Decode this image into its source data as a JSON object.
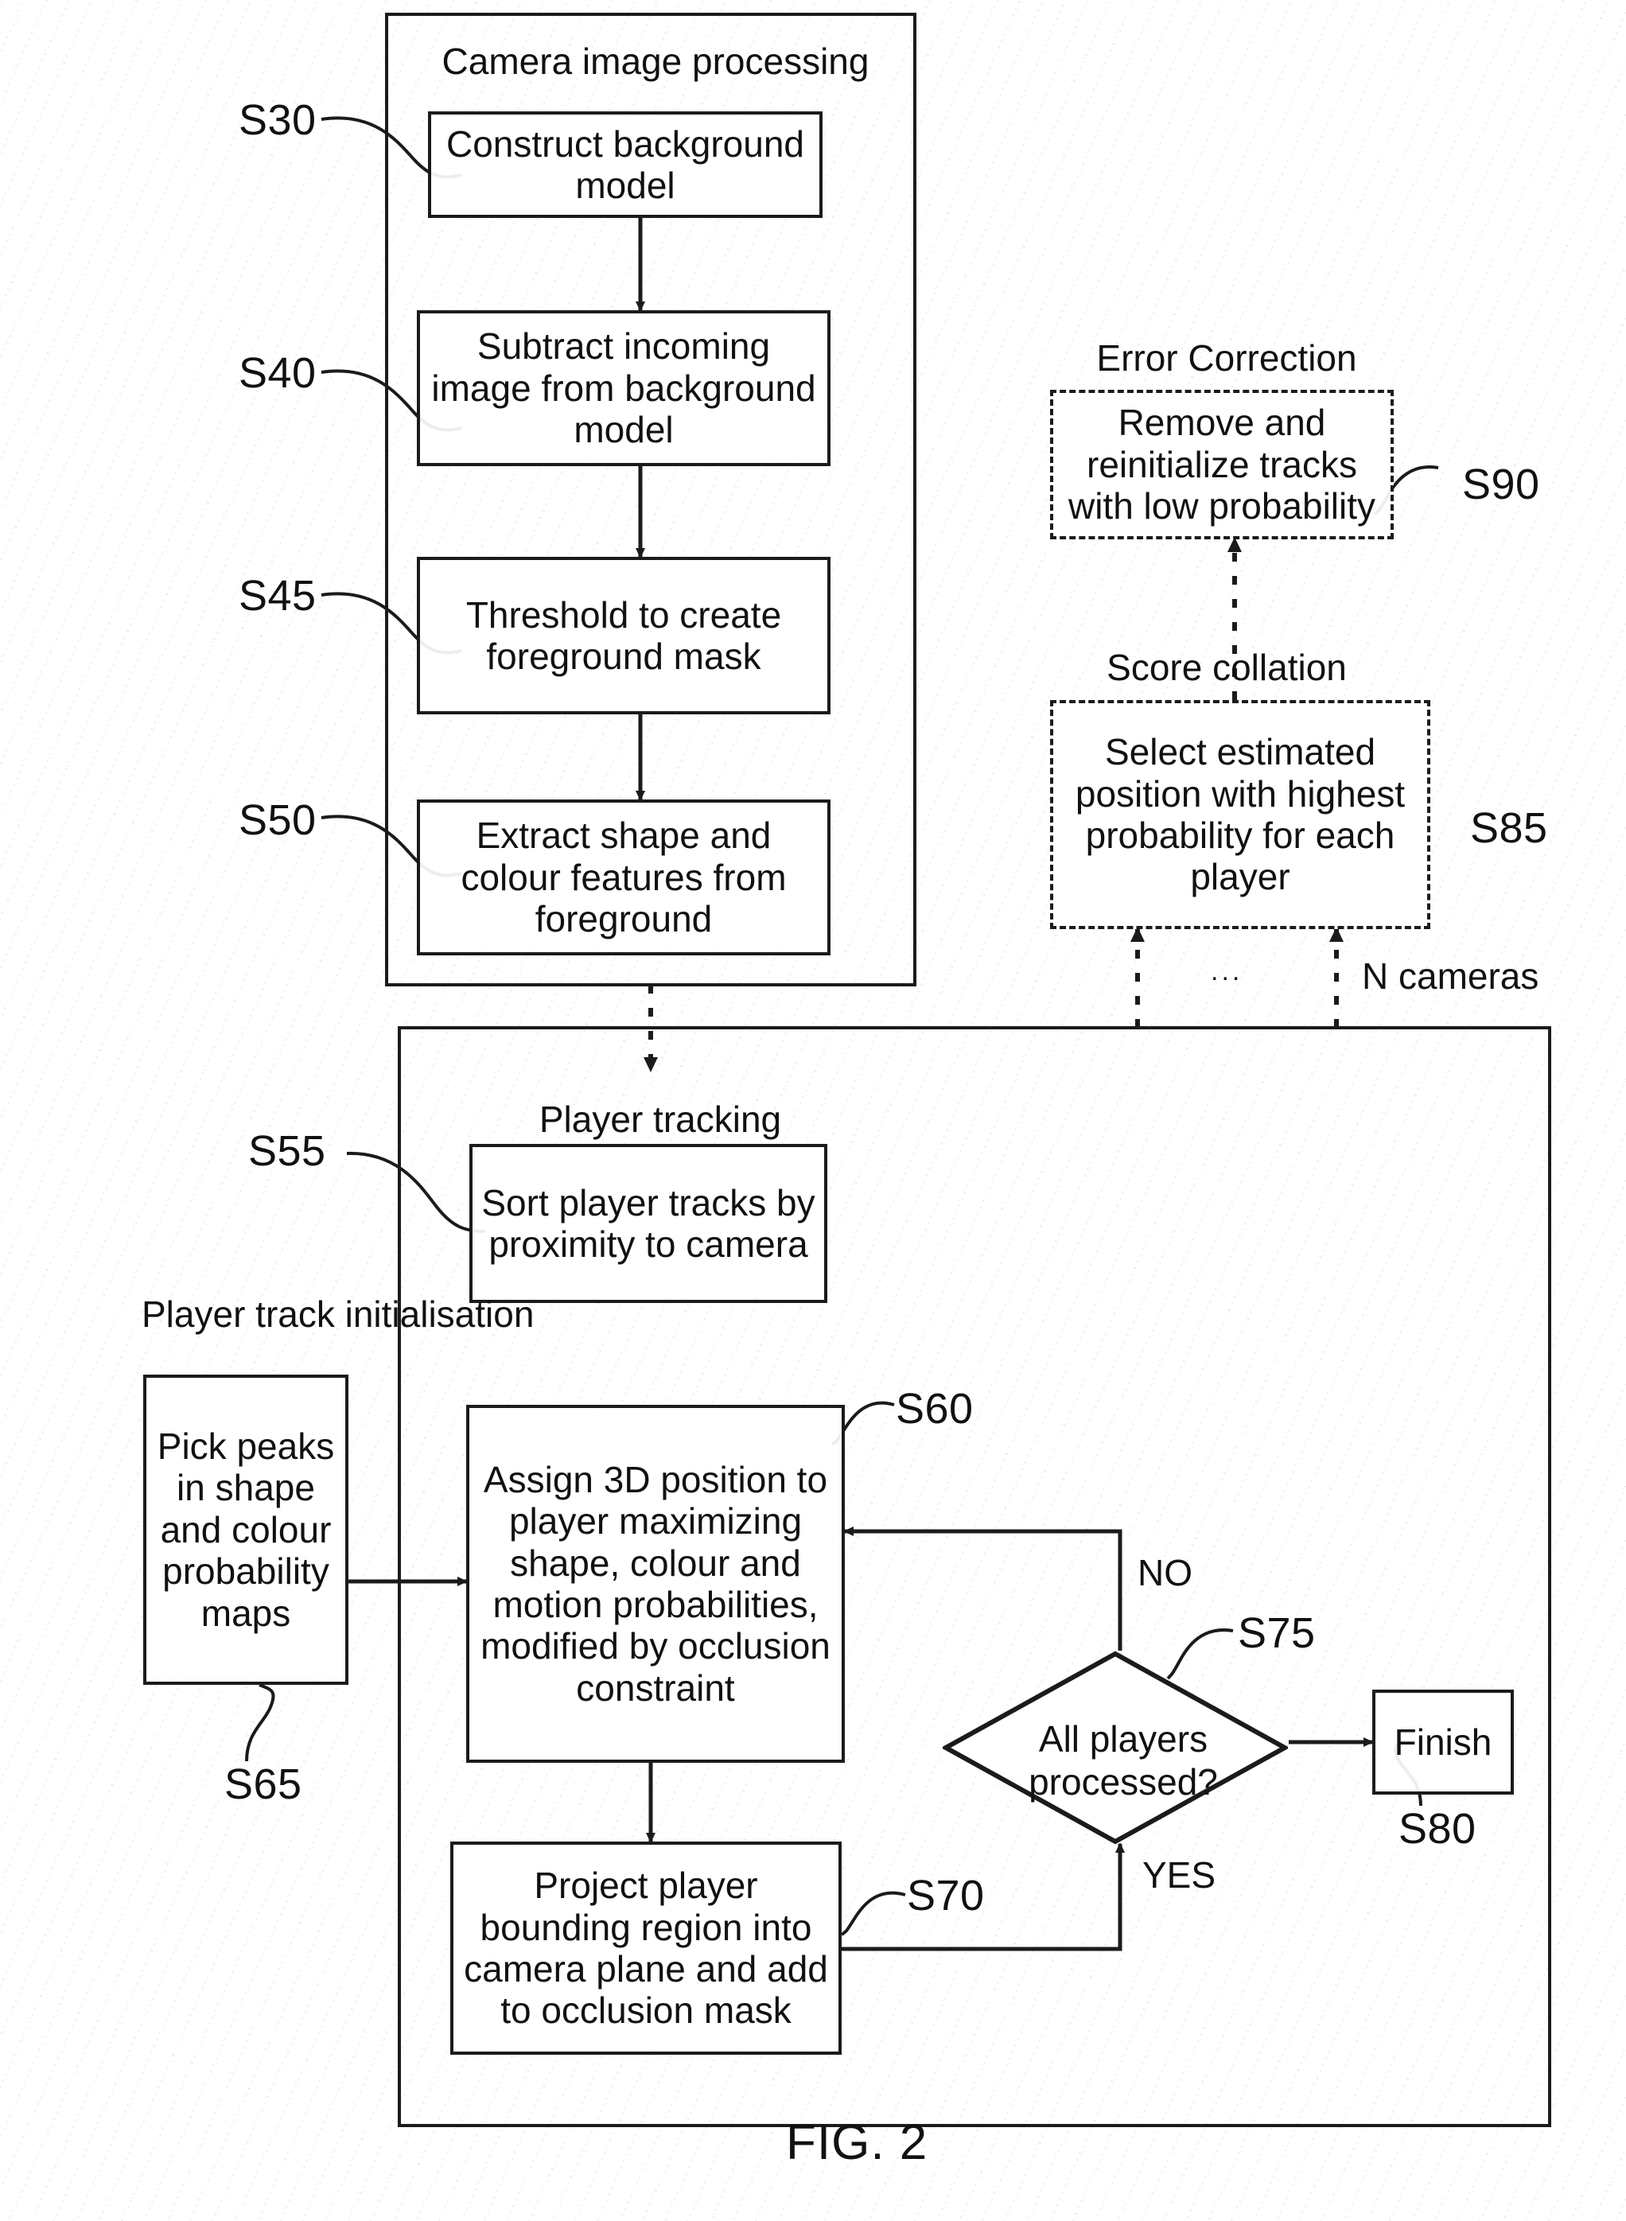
{
  "figure": {
    "caption": "FIG. 2",
    "groups": [
      {
        "id": "camera-image-processing",
        "title": "Camera image processing",
        "style": "solid"
      },
      {
        "id": "player-tracking",
        "title": "Player tracking",
        "style": "solid"
      },
      {
        "id": "error-correction",
        "title": "Error Correction",
        "style": "dashed"
      },
      {
        "id": "score-collation",
        "title": "Score collation",
        "style": "dashed"
      },
      {
        "id": "player-track-initialisation",
        "title": "Player track initialisation",
        "style": "solid"
      }
    ],
    "nodes": [
      {
        "id": "s30",
        "ref": "S30",
        "text": "Construct background model",
        "shape": "rect"
      },
      {
        "id": "s40",
        "ref": "S40",
        "text": "Subtract incoming image from background model",
        "shape": "rect"
      },
      {
        "id": "s45",
        "ref": "S45",
        "text": "Threshold to create foreground mask",
        "shape": "rect"
      },
      {
        "id": "s50",
        "ref": "S50",
        "text": "Extract shape and colour features from foreground",
        "shape": "rect"
      },
      {
        "id": "s55",
        "ref": "S55",
        "text": "Sort player tracks by proximity to camera",
        "shape": "rect"
      },
      {
        "id": "s60",
        "ref": "S60",
        "text": "Assign 3D position to player maximizing shape, colour and motion probabilities, modified by occlusion constraint",
        "shape": "rect"
      },
      {
        "id": "s65",
        "ref": "S65",
        "text": "Pick peaks in shape and colour probability maps",
        "shape": "rect"
      },
      {
        "id": "s70",
        "ref": "S70",
        "text": "Project player bounding region into camera plane and add to occlusion mask",
        "shape": "rect"
      },
      {
        "id": "s75",
        "ref": "S75",
        "text": "All players processed?",
        "shape": "diamond"
      },
      {
        "id": "s80",
        "ref": "S80",
        "text": "Finish",
        "shape": "rect"
      },
      {
        "id": "s85",
        "ref": "S85",
        "text": "Select estimated position with highest probability for each player",
        "shape": "dashed-rect"
      },
      {
        "id": "s90",
        "ref": "S90",
        "text": "Remove and reinitialize tracks with low probability",
        "shape": "dashed-rect"
      }
    ],
    "edge_labels": {
      "decision_no": "NO",
      "decision_yes": "YES",
      "cameras": "N cameras",
      "ellipsis": "..."
    },
    "colors": {
      "ink": "#1b1b1b",
      "paper": "#ffffff"
    }
  }
}
